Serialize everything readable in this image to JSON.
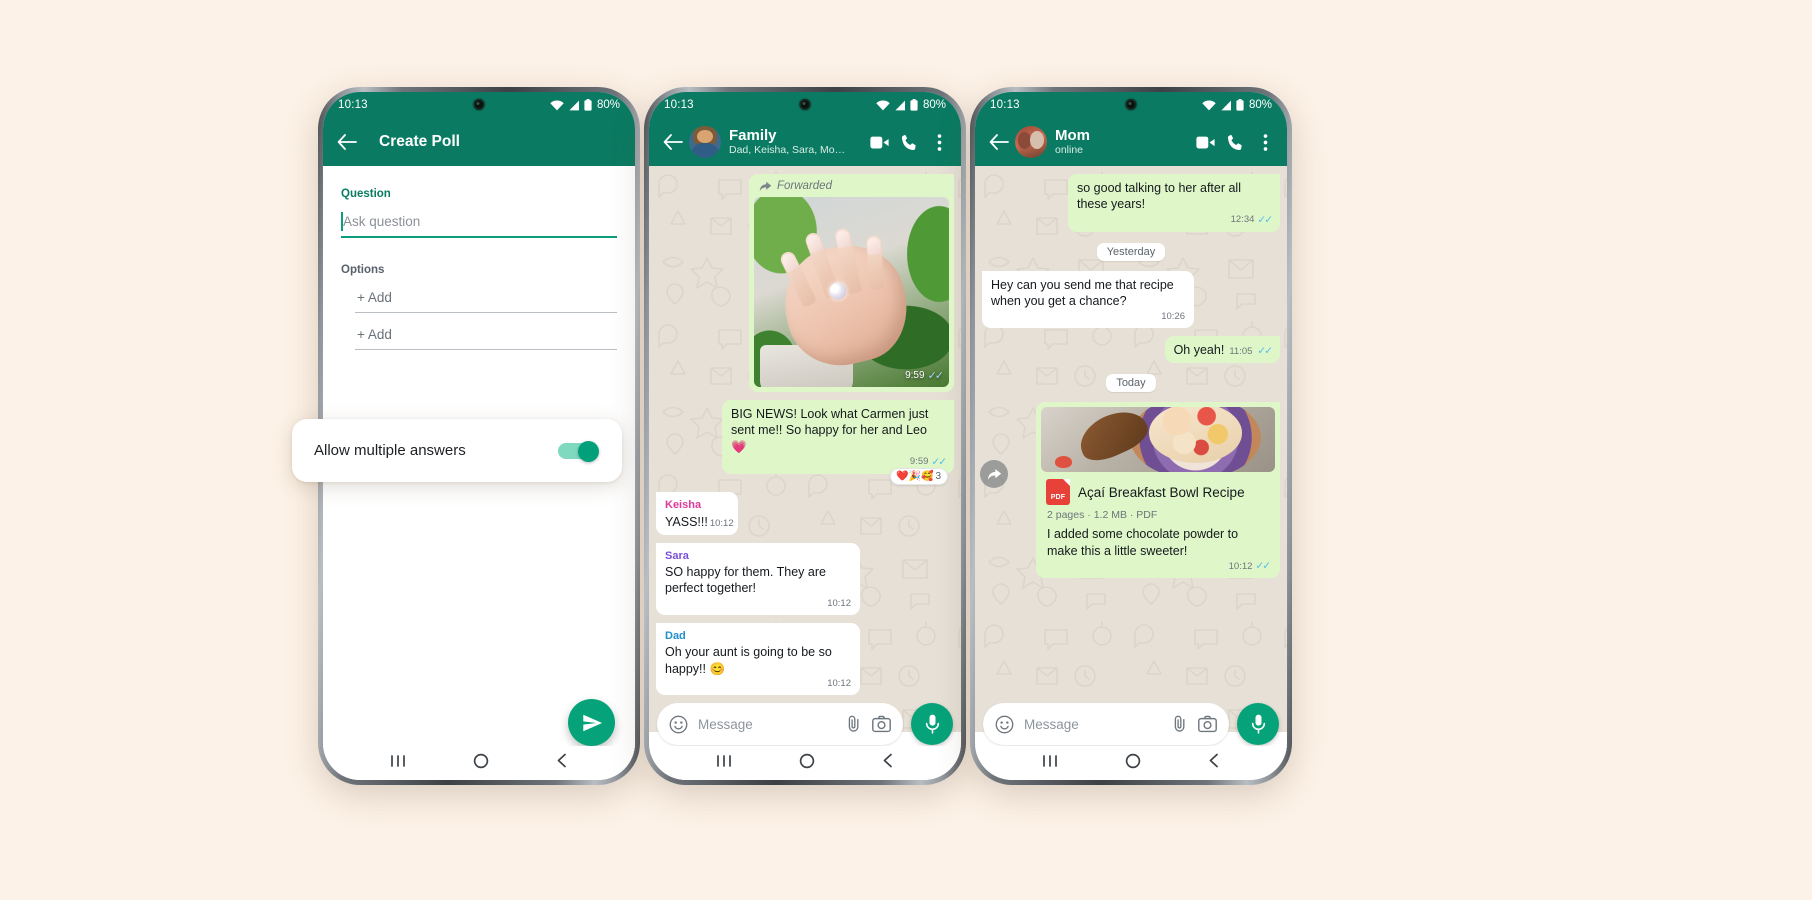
{
  "canvas": {
    "background": "#fdf2e7",
    "brand_green": "#0a7b62",
    "accent_green": "#06a37a",
    "out_bubble": "#dff7c8"
  },
  "status_bar": {
    "time": "10:13",
    "battery": "80%",
    "wifi_icon": "wifi-icon",
    "signal_icon": "signal-icon",
    "battery_icon": "battery-icon"
  },
  "phone1": {
    "app_bar": {
      "back_icon": "back-arrow-icon",
      "title": "Create Poll"
    },
    "form": {
      "question_label": "Question",
      "question_placeholder": "Ask question",
      "options_label": "Options",
      "option_rows": [
        {
          "label": "+ Add"
        },
        {
          "label": "+ Add"
        }
      ]
    },
    "send_fab": {
      "icon": "send-icon"
    },
    "toggle_card": {
      "label": "Allow multiple answers",
      "state": "on",
      "track_color": "#7fd9bf",
      "thumb_color": "#02a07a"
    },
    "nav_bar": {
      "recents_icon": "recents-icon",
      "home_icon": "home-icon",
      "back_icon": "nav-back-icon"
    }
  },
  "phone2": {
    "app_bar": {
      "back_icon": "back-arrow-icon",
      "avatar": "group-avatar",
      "name": "Family",
      "subtitle": "Dad, Keisha, Sara, Mom...",
      "video_icon": "video-call-icon",
      "call_icon": "voice-call-icon",
      "menu_icon": "overflow-menu-icon"
    },
    "forward_button": {
      "icon": "forward-arrow-icon"
    },
    "messages": [
      {
        "type": "image",
        "direction": "out",
        "forwarded_label": "Forwarded",
        "forwarded_icon": "forwarded-arrow-icon",
        "image_alt": "hand-with-engagement-ring-photo",
        "time": "9:59",
        "ticks": "read"
      },
      {
        "type": "text",
        "direction": "out",
        "text": "BIG NEWS! Look what Carmen just sent me!! So happy for her and Leo 💗",
        "time": "9:59",
        "ticks": "read",
        "reactions": {
          "emojis": "❤️🎉🥰",
          "count": "3"
        }
      },
      {
        "type": "text",
        "direction": "in",
        "sender": "Keisha",
        "sender_color": "#e0399b",
        "text": "YASS!!!",
        "time": "10:12"
      },
      {
        "type": "text",
        "direction": "in",
        "sender": "Sara",
        "sender_color": "#7a4ed6",
        "text": "SO happy for them. They are perfect together!",
        "time": "10:12"
      },
      {
        "type": "text",
        "direction": "in",
        "sender": "Dad",
        "sender_color": "#1f8ecb",
        "text": "Oh your aunt is going to be so happy!! 😊",
        "time": "10:12"
      }
    ],
    "composer": {
      "emoji_icon": "emoji-icon",
      "placeholder": "Message",
      "attach_icon": "paperclip-icon",
      "camera_icon": "camera-icon",
      "mic_icon": "microphone-icon"
    },
    "nav_bar": {
      "recents_icon": "recents-icon",
      "home_icon": "home-icon",
      "back_icon": "nav-back-icon"
    }
  },
  "phone3": {
    "app_bar": {
      "back_icon": "back-arrow-icon",
      "avatar": "mom-avatar",
      "name": "Mom",
      "subtitle": "online",
      "video_icon": "video-call-icon",
      "call_icon": "voice-call-icon",
      "menu_icon": "overflow-menu-icon"
    },
    "forward_button": {
      "icon": "forward-arrow-icon"
    },
    "messages": [
      {
        "type": "text",
        "direction": "out",
        "text": "so good talking to her after all these years!",
        "time": "12:34",
        "ticks": "read"
      },
      {
        "type": "daychip",
        "text": "Yesterday"
      },
      {
        "type": "text",
        "direction": "in",
        "text": "Hey can you send me that recipe when you get a chance?",
        "time": "10:26"
      },
      {
        "type": "text",
        "direction": "out",
        "text": "Oh yeah!",
        "time": "11:05",
        "ticks": "read"
      },
      {
        "type": "daychip",
        "text": "Today"
      },
      {
        "type": "document",
        "direction": "out",
        "thumbnail_alt": "acai-breakfast-bowl-photo",
        "file_icon": "pdf-icon",
        "file_icon_label": "PDF",
        "title": "Açaí Breakfast Bowl Recipe",
        "meta": "2 pages · 1.2 MB · PDF",
        "caption": "I added some chocolate powder to make this a little sweeter!",
        "time": "10:12",
        "ticks": "read"
      }
    ],
    "composer": {
      "emoji_icon": "emoji-icon",
      "placeholder": "Message",
      "attach_icon": "paperclip-icon",
      "camera_icon": "camera-icon",
      "mic_icon": "microphone-icon"
    },
    "nav_bar": {
      "recents_icon": "recents-icon",
      "home_icon": "home-icon",
      "back_icon": "nav-back-icon"
    }
  }
}
